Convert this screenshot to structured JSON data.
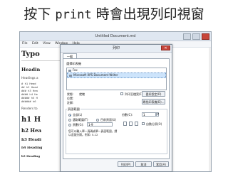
{
  "slide": {
    "title_prefix": "按下",
    "title_code": "print",
    "title_suffix": "時會出現列印視窗"
  },
  "editor": {
    "window_title": "Untitled Document.md",
    "menu": [
      "File",
      "Edit",
      "View",
      "Window",
      "Help"
    ],
    "content": {
      "typo": "Typo",
      "heading": "Headin",
      "small": "Headings a",
      "code_lines": [
        "# h1 Head",
        "## h2 Head",
        "### h3 Hea",
        "#### h4 He",
        "##### h5 H",
        "###### h6"
      ],
      "renders": "Renders to",
      "h1": "h1 H",
      "h2": "h2 Hea",
      "h3": "h3 Headi",
      "h4": "h4 Heading",
      "h5": "h5 Heading"
    }
  },
  "dialog": {
    "title": "列印",
    "close": "✕",
    "tab": "一般",
    "select_printer_label": "選擇印表機",
    "printers": [
      "Fax",
      "Microsoft XPS Document Writer"
    ],
    "status_label": "狀態:",
    "status_value": "就緒",
    "location_label": "位置:",
    "comment_label": "註解:",
    "print_to_file": "列印至檔案(F)",
    "preferences_button": "喜好設定(R)",
    "find_printer_button": "尋找印表機(D)...",
    "page_range_label": "頁面範圍",
    "range_all": "全部(L)",
    "range_selection": "選取範圍(T)",
    "range_current": "目前頁面(U)",
    "range_pages": "頁數(G):",
    "pages_value": "1-9",
    "copies_label": "份數(C):",
    "copies_value": "1",
    "collate": "自動分頁(O)",
    "note": "您可以輸入單一頁碼或單一頁面範圍，請以逗號分隔。例如: 5-12",
    "print_button": "列印(P)",
    "cancel_button": "取消",
    "apply_button": "套用(A)"
  },
  "colors": {
    "selection": "#cde4fb",
    "close": "#c7463a",
    "radio": "#1f6fc4"
  }
}
